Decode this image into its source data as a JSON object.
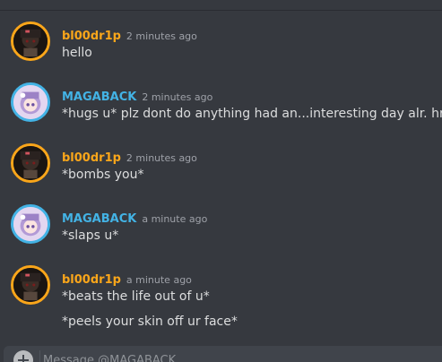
{
  "messages": [
    {
      "username": "bl00dr1p",
      "timestamp": "2 minutes ago",
      "lines": [
        "hello"
      ],
      "avatar": "orange-avatar"
    },
    {
      "username": "MAGABACK",
      "timestamp": "2 minutes ago",
      "lines": [
        "*hugs u* plz dont do anything had an...interesting day alr. hru\\"
      ],
      "avatar": "blue-avatar"
    },
    {
      "username": "bl00dr1p",
      "timestamp": "2 minutes ago",
      "lines": [
        "*bombs you*"
      ],
      "avatar": "orange-avatar"
    },
    {
      "username": "MAGABACK",
      "timestamp": "a minute ago",
      "lines": [
        "*slaps u*"
      ],
      "avatar": "blue-avatar"
    },
    {
      "username": "bl00dr1p",
      "timestamp": "a minute ago",
      "lines": [
        "*beats the life out of u*",
        "*peels your skin off ur face*"
      ],
      "avatar": "orange-avatar"
    }
  ],
  "composer": {
    "placeholder": "Message @MAGABACK",
    "add_icon": "plus-circle-icon"
  },
  "colors": {
    "background": "#36393f",
    "orange_user": "#faa61a",
    "blue_user": "#43b3e5",
    "text": "#dcddde",
    "timestamp": "#9ea1a8",
    "composer_bg": "#40444b"
  }
}
